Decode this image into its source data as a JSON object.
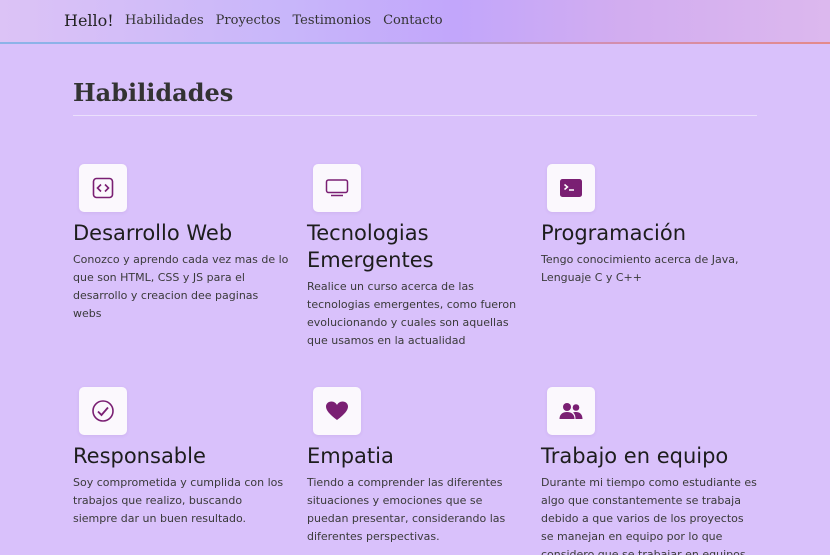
{
  "navbar": {
    "brand": "Hello!",
    "links": [
      "Habilidades",
      "Proyectos",
      "Testimonios",
      "Contacto"
    ]
  },
  "section": {
    "title": "Habilidades"
  },
  "cards": [
    {
      "icon": "code-square-icon",
      "title": "Desarrollo Web",
      "text": "Conozco y aprendo cada vez mas de lo que son HTML, CSS y JS para el desarrollo y creacion dee paginas webs"
    },
    {
      "icon": "display-icon",
      "title": "Tecnologias Emergentes",
      "text": "Realice un curso acerca de las tecnologias emergentes, como fueron evolucionando y cuales son aquellas que usamos en la actualidad"
    },
    {
      "icon": "terminal-icon",
      "title": "Programación",
      "text": "Tengo conocimiento acerca de Java, Lenguaje C y C++"
    },
    {
      "icon": "check-circle-icon",
      "title": "Responsable",
      "text": "Soy comprometida y cumplida con los trabajos que realizo, buscando siempre dar un buen resultado."
    },
    {
      "icon": "heart-icon",
      "title": "Empatia",
      "text": "Tiendo a comprender las diferentes situaciones y emociones que se puedan presentar, considerando las diferentes perspectivas."
    },
    {
      "icon": "people-icon",
      "title": "Trabajo en equipo",
      "text": "Durante mi tiempo como estudiante es algo que constantemente se trabaja debido a que varios de los proyectos se manejan en equipo por lo que considero que se trabajar en equipos con distintas"
    }
  ],
  "colors": {
    "accent": "#7a1f73",
    "background": "#d9c1fb"
  }
}
